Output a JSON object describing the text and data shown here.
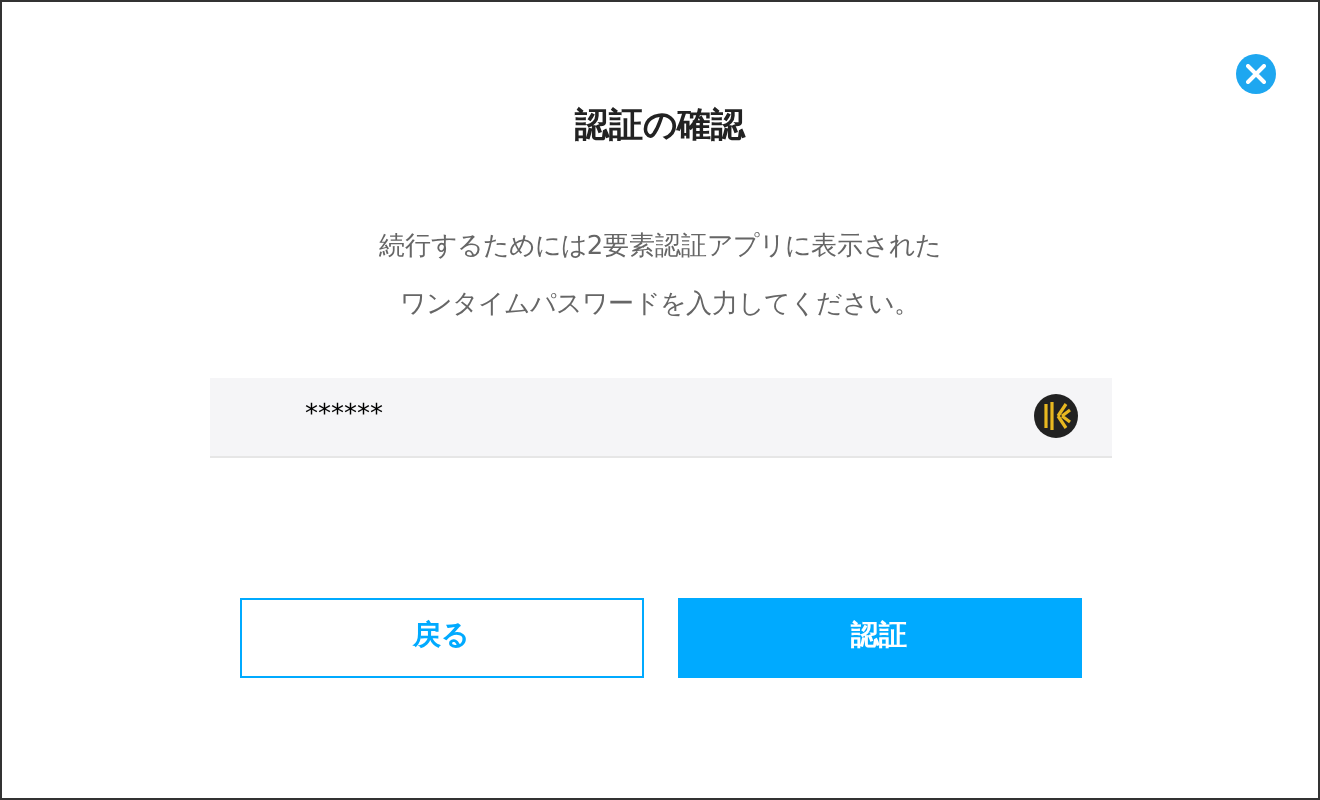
{
  "dialog": {
    "title": "認証の確認",
    "message_lines": [
      "続行するためには2要素認証アプリに表示された",
      "ワンタイムパスワードを入力してください。"
    ],
    "code_field": {
      "value": "******"
    },
    "buttons": [
      {
        "label": "戻る",
        "kind": "secondary"
      },
      {
        "label": "認証",
        "kind": "primary"
      }
    ]
  }
}
